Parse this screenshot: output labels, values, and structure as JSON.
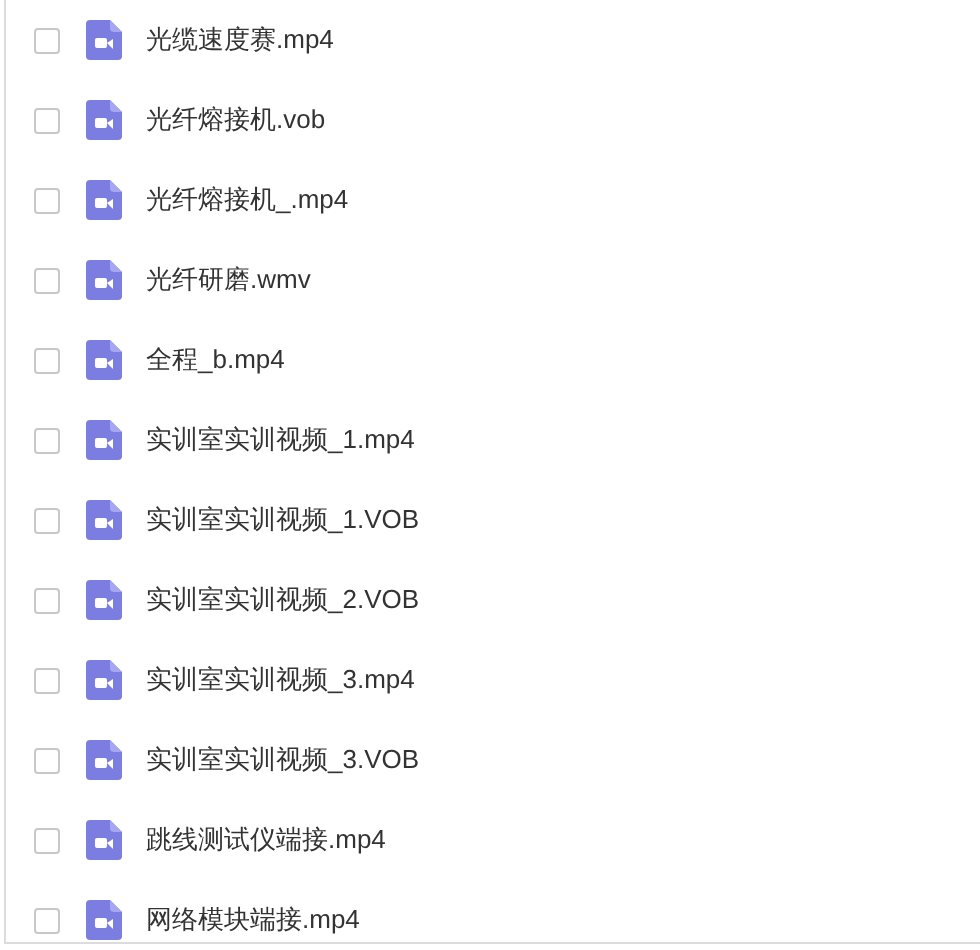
{
  "files": [
    {
      "name": "光缆速度赛.mp4",
      "checked": false
    },
    {
      "name": "光纤熔接机.vob",
      "checked": false
    },
    {
      "name": "光纤熔接机_.mp4",
      "checked": false
    },
    {
      "name": "光纤研磨.wmv",
      "checked": false
    },
    {
      "name": "全程_b.mp4",
      "checked": false
    },
    {
      "name": "实训室实训视频_1.mp4",
      "checked": false
    },
    {
      "name": "实训室实训视频_1.VOB",
      "checked": false
    },
    {
      "name": "实训室实训视频_2.VOB",
      "checked": false
    },
    {
      "name": "实训室实训视频_3.mp4",
      "checked": false
    },
    {
      "name": "实训室实训视频_3.VOB",
      "checked": false
    },
    {
      "name": "跳线测试仪端接.mp4",
      "checked": false
    },
    {
      "name": "网络模块端接.mp4",
      "checked": false
    }
  ]
}
